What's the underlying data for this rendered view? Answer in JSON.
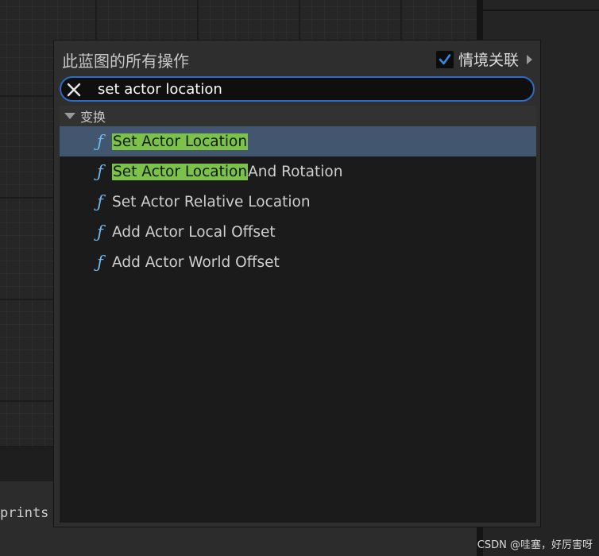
{
  "popup": {
    "title": "此蓝图的所有操作",
    "context_label": "情境关联",
    "context_checked": true
  },
  "search": {
    "value": "set actor location"
  },
  "category": {
    "label": "变换"
  },
  "results": [
    {
      "highlight": "Set Actor Location",
      "rest": "",
      "selected": true
    },
    {
      "highlight": "Set Actor Location",
      "rest": " And Rotation",
      "selected": false
    },
    {
      "highlight": "",
      "rest": "Set Actor Relative Location",
      "selected": false
    },
    {
      "highlight": "",
      "rest": "Add Actor Local Offset",
      "selected": false
    },
    {
      "highlight": "",
      "rest": "Add Actor World Offset",
      "selected": false
    }
  ],
  "background": {
    "prints_text": "prints",
    "watermark": "CSDN @哇塞，好厉害呀"
  },
  "colors": {
    "accent_blue": "#2d6bc4",
    "highlight_green": "#7cc24a",
    "function_icon": "#6fb8ee",
    "selected_row": "#425670"
  },
  "icons": {
    "function": "function-f-icon",
    "clear": "close-icon",
    "checkbox": "checkmark-icon"
  }
}
